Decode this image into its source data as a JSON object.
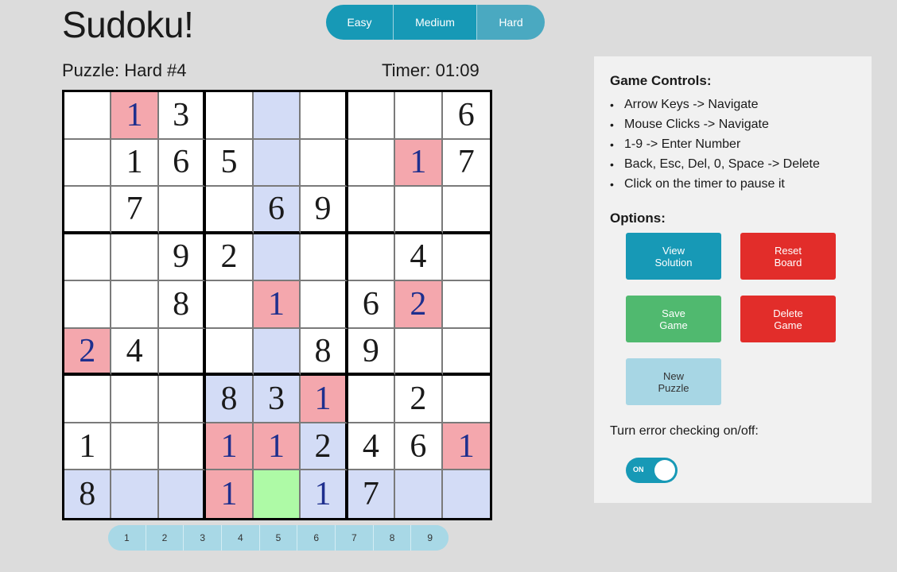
{
  "header": {
    "title": "Sudoku!",
    "puzzle_label": "Puzzle: Hard #4",
    "timer": "Timer: 01:09"
  },
  "difficulty": {
    "options": [
      {
        "label": "Easy",
        "active": false
      },
      {
        "label": "Medium",
        "active": false
      },
      {
        "label": "Hard",
        "active": true
      }
    ]
  },
  "board": {
    "selected": [
      8,
      4
    ],
    "highlight_colors": {
      "highlight": "#d3dcf6",
      "error": "#f4a7ad",
      "selected": "#aefaa6",
      "user_digit": "#1e2f8e"
    },
    "rows": [
      [
        {
          "v": ""
        },
        {
          "v": "1",
          "user": true,
          "err": true
        },
        {
          "v": "3"
        },
        {
          "v": ""
        },
        {
          "v": "",
          "hl": true
        },
        {
          "v": ""
        },
        {
          "v": ""
        },
        {
          "v": ""
        },
        {
          "v": "6"
        }
      ],
      [
        {
          "v": ""
        },
        {
          "v": "1"
        },
        {
          "v": "6"
        },
        {
          "v": "5"
        },
        {
          "v": "",
          "hl": true
        },
        {
          "v": ""
        },
        {
          "v": ""
        },
        {
          "v": "1",
          "user": true,
          "err": true
        },
        {
          "v": "7"
        }
      ],
      [
        {
          "v": ""
        },
        {
          "v": "7"
        },
        {
          "v": ""
        },
        {
          "v": ""
        },
        {
          "v": "6",
          "hl": true
        },
        {
          "v": "9"
        },
        {
          "v": ""
        },
        {
          "v": ""
        },
        {
          "v": ""
        }
      ],
      [
        {
          "v": ""
        },
        {
          "v": ""
        },
        {
          "v": "9"
        },
        {
          "v": "2"
        },
        {
          "v": "",
          "hl": true
        },
        {
          "v": ""
        },
        {
          "v": ""
        },
        {
          "v": "4"
        },
        {
          "v": ""
        }
      ],
      [
        {
          "v": ""
        },
        {
          "v": ""
        },
        {
          "v": "8"
        },
        {
          "v": ""
        },
        {
          "v": "1",
          "user": true,
          "err": true
        },
        {
          "v": ""
        },
        {
          "v": "6"
        },
        {
          "v": "2",
          "user": true,
          "err": true
        },
        {
          "v": ""
        }
      ],
      [
        {
          "v": "2",
          "user": true,
          "err": true
        },
        {
          "v": "4"
        },
        {
          "v": ""
        },
        {
          "v": ""
        },
        {
          "v": "",
          "hl": true
        },
        {
          "v": "8"
        },
        {
          "v": "9"
        },
        {
          "v": ""
        },
        {
          "v": ""
        }
      ],
      [
        {
          "v": ""
        },
        {
          "v": ""
        },
        {
          "v": ""
        },
        {
          "v": "8",
          "hl": true
        },
        {
          "v": "3",
          "hl": true
        },
        {
          "v": "1",
          "user": true,
          "err": true
        },
        {
          "v": ""
        },
        {
          "v": "2"
        },
        {
          "v": ""
        }
      ],
      [
        {
          "v": "1"
        },
        {
          "v": ""
        },
        {
          "v": ""
        },
        {
          "v": "1",
          "user": true,
          "err": true
        },
        {
          "v": "1",
          "user": true,
          "err": true
        },
        {
          "v": "2",
          "hl": true
        },
        {
          "v": "4"
        },
        {
          "v": "6"
        },
        {
          "v": "1",
          "user": true,
          "err": true
        }
      ],
      [
        {
          "v": "8",
          "hl": true
        },
        {
          "v": "",
          "hl": true
        },
        {
          "v": "",
          "hl": true
        },
        {
          "v": "1",
          "user": true,
          "err": true
        },
        {
          "v": "",
          "sel": true
        },
        {
          "v": "1",
          "user": true,
          "hl": true
        },
        {
          "v": "7",
          "hl": true
        },
        {
          "v": "",
          "hl": true
        },
        {
          "v": "",
          "hl": true
        }
      ]
    ]
  },
  "numpad": {
    "digits": [
      "1",
      "2",
      "3",
      "4",
      "5",
      "6",
      "7",
      "8",
      "9"
    ]
  },
  "panel": {
    "controls_title": "Game Controls:",
    "controls": [
      "Arrow Keys -> Navigate",
      "Mouse Clicks -> Navigate",
      "1-9 -> Enter Number",
      "Back, Esc, Del, 0, Space -> Delete",
      "Click on the timer to pause it"
    ],
    "bullet": "•",
    "options_title": "Options:",
    "buttons": {
      "view_solution": [
        "View",
        "Solution"
      ],
      "reset_board": [
        "Reset",
        "Board"
      ],
      "save_game": [
        "Save",
        "Game"
      ],
      "delete_game": [
        "Delete",
        "Game"
      ],
      "new_puzzle": [
        "New",
        "Puzzle"
      ]
    },
    "toggle_label": "Turn error checking on/off:",
    "toggle": {
      "state": "ON",
      "on": true
    }
  }
}
